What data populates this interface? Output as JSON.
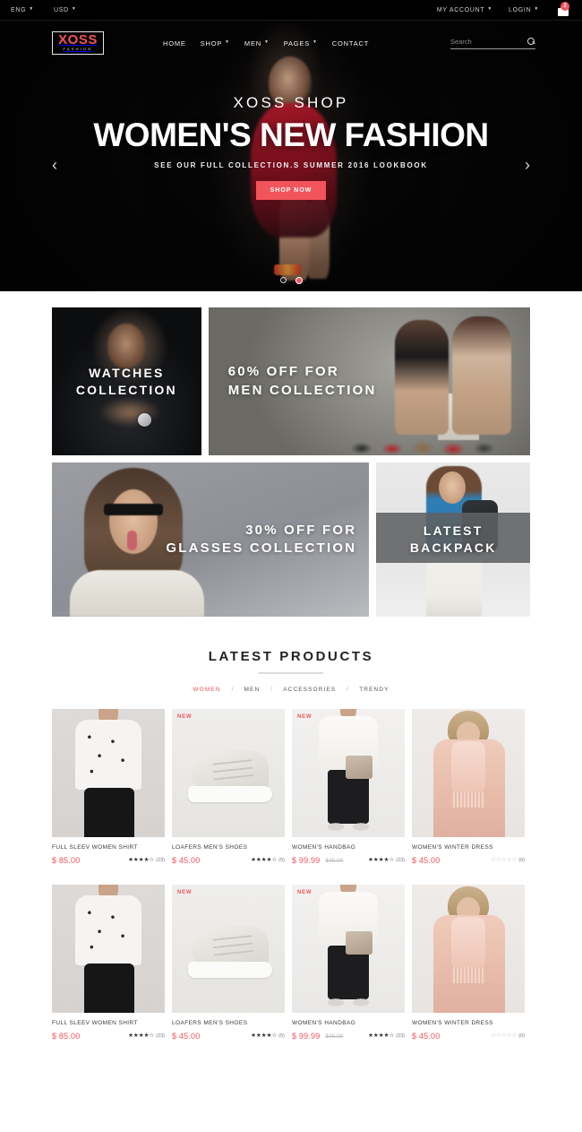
{
  "topbar": {
    "language": "ENG",
    "currency": "USD",
    "my_account": "MY ACCOUNT",
    "login": "LOGIN",
    "cart_count": "2",
    "cart_icon": "shopping-bag-icon"
  },
  "header": {
    "logo_main": "XOSS",
    "logo_sub": "FASHION",
    "nav": [
      {
        "label": "HOME",
        "has_dropdown": false
      },
      {
        "label": "SHOP",
        "has_dropdown": true
      },
      {
        "label": "MEN",
        "has_dropdown": true
      },
      {
        "label": "PAGES",
        "has_dropdown": true
      },
      {
        "label": "CONTACT",
        "has_dropdown": false
      }
    ],
    "search_placeholder": "Search",
    "search_value": "",
    "search_icon": "search-icon"
  },
  "hero": {
    "eyebrow": "XOSS SHOP",
    "title": "WOMEN'S NEW FASHION",
    "subtitle": "SEE OUR FULL COLLECTION.S SUMMER 2016 LOOKBOOK",
    "cta": "SHOP NOW",
    "prev_arrow": "‹",
    "next_arrow": "›",
    "slides": 2,
    "active_slide": 2
  },
  "promos": [
    {
      "line1": "WATCHES",
      "line2": "COLLECTION"
    },
    {
      "line1": "60% OFF FOR",
      "line2": "MEN COLLECTION"
    },
    {
      "line1": "30% OFF FOR",
      "line2": "GLASSES COLLECTION"
    },
    {
      "line1": "LATEST",
      "line2": "BACKPACK"
    }
  ],
  "products_section": {
    "title": "LATEST PRODUCTS",
    "tabs": [
      {
        "label": "WOMEN",
        "active": true
      },
      {
        "label": "MEN",
        "active": false
      },
      {
        "label": "ACCESSORIES",
        "active": false
      },
      {
        "label": "TRENDY",
        "active": false
      }
    ],
    "separator": "/"
  },
  "products": [
    {
      "name": "FULL SLEEV WOMEN SHIRT",
      "price": "$ 85.00",
      "old_price": "",
      "badge": "",
      "stars_full": 4,
      "stars_half": 1,
      "rating_count": "(23)"
    },
    {
      "name": "LOAFERS MEN'S SHOES",
      "price": "$ 45.00",
      "old_price": "",
      "badge": "NEW",
      "stars_full": 4,
      "stars_half": 1,
      "rating_count": "(5)"
    },
    {
      "name": "WOMEN'S HANDBAG",
      "price": "$ 99.99",
      "old_price": "$45.00",
      "badge": "NEW",
      "stars_full": 4,
      "stars_half": 1,
      "rating_count": "(23)"
    },
    {
      "name": "WOMEN'S WINTER DRESS",
      "price": "$ 45.00",
      "old_price": "",
      "badge": "",
      "stars_full": 0,
      "stars_half": 0,
      "rating_count": "(0)"
    },
    {
      "name": "FULL SLEEV WOMEN SHIRT",
      "price": "$ 85.00",
      "old_price": "",
      "badge": "",
      "stars_full": 4,
      "stars_half": 1,
      "rating_count": "(23)"
    },
    {
      "name": "LOAFERS MEN'S SHOES",
      "price": "$ 45.00",
      "old_price": "",
      "badge": "NEW",
      "stars_full": 4,
      "stars_half": 1,
      "rating_count": "(5)"
    },
    {
      "name": "WOMEN'S HANDBAG",
      "price": "$ 99.99",
      "old_price": "$45.00",
      "badge": "NEW",
      "stars_full": 4,
      "stars_half": 1,
      "rating_count": "(23)"
    },
    {
      "name": "WOMEN'S WINTER DRESS",
      "price": "$ 45.00",
      "old_price": "",
      "badge": "",
      "stars_full": 0,
      "stars_half": 0,
      "rating_count": "(0)"
    }
  ],
  "colors": {
    "accent": "#f2545b",
    "dark": "#000000",
    "text": "#333333"
  }
}
